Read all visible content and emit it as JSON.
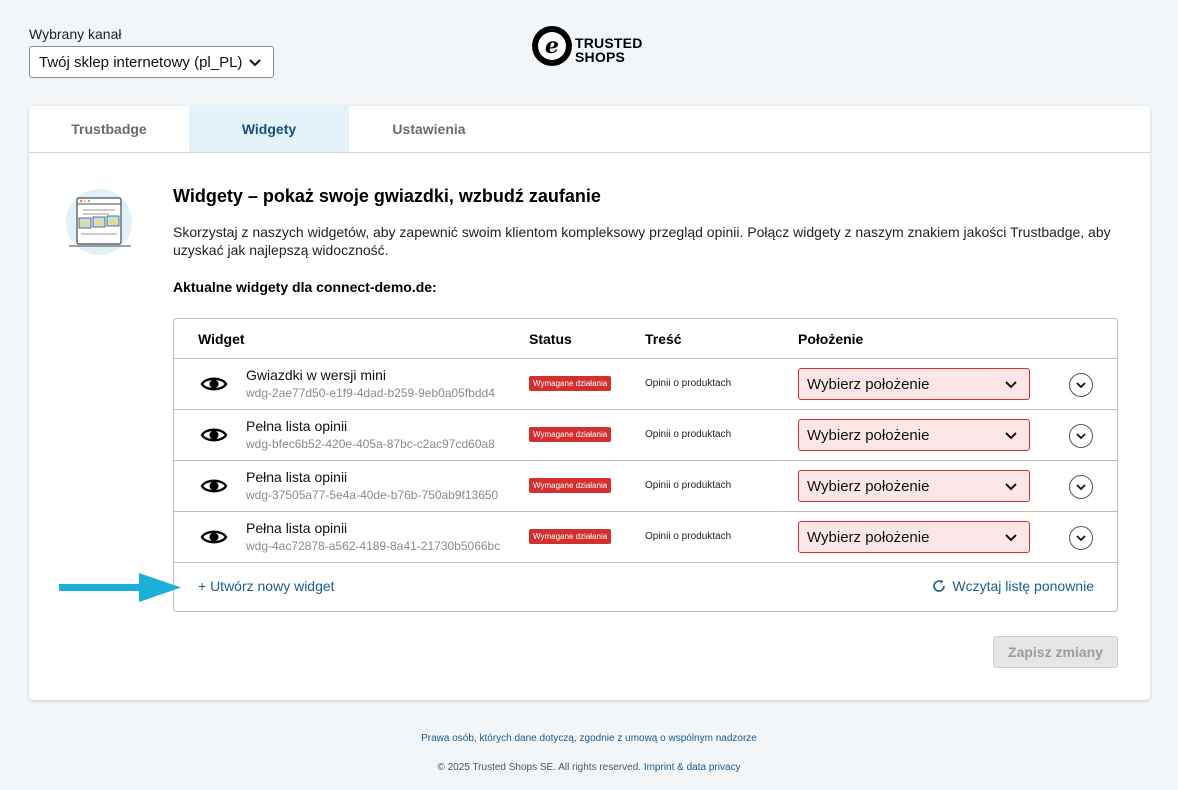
{
  "channel": {
    "label": "Wybrany kanał",
    "selected": "Twój sklep internetowy (pl_PL)"
  },
  "logo": {
    "line1": "TRUSTED",
    "line2": "SHOPS"
  },
  "tabs": [
    {
      "label": "Trustbadge",
      "active": false
    },
    {
      "label": "Widgety",
      "active": true
    },
    {
      "label": "Ustawienia",
      "active": false
    }
  ],
  "main": {
    "heading": "Widgety – pokaż swoje gwiazdki, wzbudź zaufanie",
    "description": "Skorzystaj z naszych widgetów, aby zapewnić swoim klientom kompleksowy przegląd opinii. Połącz widgety z naszym znakiem jakości Trustbadge, aby uzyskać jak najlepszą widoczność.",
    "current_widgets_label": "Aktualne widgety dla connect-demo.de:"
  },
  "table": {
    "headers": {
      "widget": "Widget",
      "status": "Status",
      "content": "Treść",
      "position": "Położenie"
    },
    "rows": [
      {
        "name": "Gwiazdki w wersji mini",
        "id": "wdg-2ae77d50-e1f9-4dad-b259-9eb0a05fbdd4",
        "status": "Wymagane działania",
        "content": "Opinii o produktach",
        "position": "Wybierz położenie"
      },
      {
        "name": "Pełna lista opinii",
        "id": "wdg-bfec6b52-420e-405a-87bc-c2ac97cd60a8",
        "status": "Wymagane działania",
        "content": "Opinii o produktach",
        "position": "Wybierz położenie"
      },
      {
        "name": "Pełna lista opinii",
        "id": "wdg-37505a77-5e4a-40de-b76b-750ab9f13650",
        "status": "Wymagane działania",
        "content": "Opinii o produktach",
        "position": "Wybierz położenie"
      },
      {
        "name": "Pełna lista opinii",
        "id": "wdg-4ac72878-a562-4189-8a41-21730b5066bc",
        "status": "Wymagane działania",
        "content": "Opinii o produktach",
        "position": "Wybierz położenie"
      }
    ],
    "create_label": "+ Utwórz nowy widget",
    "reload_label": "Wczytaj listę ponownie"
  },
  "save_label": "Zapisz zmiany",
  "footer": {
    "privacy_link": "Prawa osób, których dane dotyczą, zgodnie z umową o wspólnym nadzorze",
    "copyright": "© 2025 Trusted Shops SE. All rights reserved.",
    "imprint_link": "Imprint & data privacy"
  },
  "colors": {
    "accent": "#1a5c8f",
    "status_red": "#d32f2f",
    "select_error_bg": "#fde6e8",
    "active_tab_bg": "#e4f3fa",
    "arrow": "#1ab0d8"
  }
}
